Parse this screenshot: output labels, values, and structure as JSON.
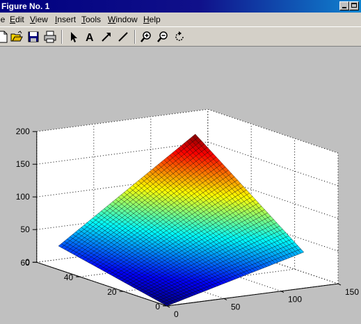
{
  "window": {
    "title": "Figure No. 1"
  },
  "menubar": {
    "items": [
      {
        "label": "le",
        "accel_index": -1
      },
      {
        "label": "Edit",
        "accel_index": 0
      },
      {
        "label": "View",
        "accel_index": 0
      },
      {
        "label": "Insert",
        "accel_index": 0
      },
      {
        "label": "Tools",
        "accel_index": 0
      },
      {
        "label": "Window",
        "accel_index": 0
      },
      {
        "label": "Help",
        "accel_index": 0
      }
    ]
  },
  "toolbar": {
    "buttons": [
      {
        "name": "new-file-icon"
      },
      {
        "name": "open-folder-icon"
      },
      {
        "name": "save-icon"
      },
      {
        "name": "print-icon"
      },
      {
        "name": "select-arrow-icon"
      },
      {
        "name": "insert-text-icon"
      },
      {
        "name": "insert-arrow-icon"
      },
      {
        "name": "insert-line-icon"
      },
      {
        "name": "zoom-in-icon"
      },
      {
        "name": "zoom-out-icon"
      },
      {
        "name": "rotate-3d-icon"
      }
    ]
  },
  "chart_data": {
    "type": "surface",
    "title": "",
    "colormap": "jet",
    "grid": true,
    "box": true,
    "x_ticks": [
      "0",
      "50",
      "100",
      "150"
    ],
    "y_ticks": [
      "0",
      "20",
      "40",
      "60"
    ],
    "z_ticks": [
      "0",
      "50",
      "100",
      "150",
      "200"
    ],
    "xlim": [
      0,
      150
    ],
    "ylim": [
      0,
      60
    ],
    "zlim": [
      0,
      200
    ],
    "surface": {
      "x_range": [
        0,
        120
      ],
      "y_range": [
        0,
        50
      ],
      "z_at_corners": {
        "x0_y0": 0,
        "xmax_y0": 55,
        "x0_ymax": 36,
        "xmax_ymax": 180
      },
      "x_steps": 48,
      "y_steps": 36
    }
  }
}
